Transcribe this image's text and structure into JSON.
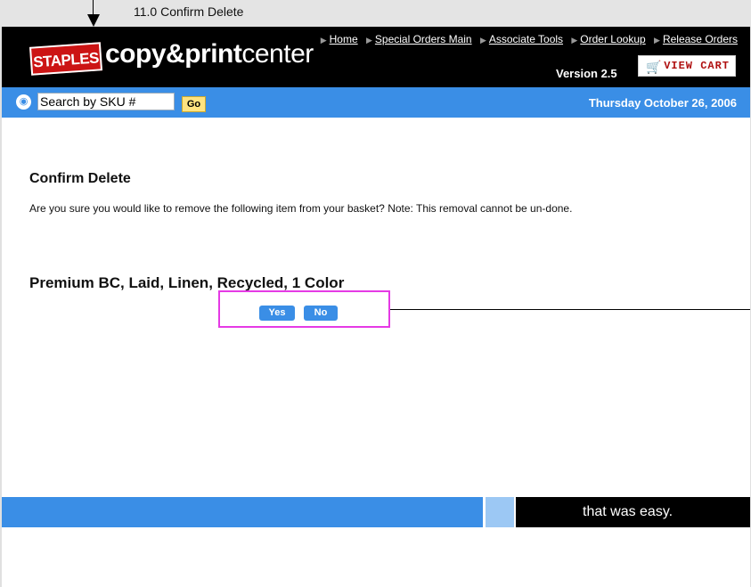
{
  "annotation": {
    "title": "11.0 Confirm Delete"
  },
  "header": {
    "brand_badge": "STAPLES",
    "brand_copy": "copy",
    "brand_amp": "&",
    "brand_print": "print",
    "brand_center": "center",
    "nav_links": [
      "Home",
      "Special Orders Main",
      "Associate Tools",
      "Order Lookup",
      "Release Orders"
    ],
    "version": "Version 2.5",
    "view_cart_label": "VIEW CART"
  },
  "search": {
    "value": "Search by SKU #",
    "go_label": "Go",
    "date": "Thursday October 26, 2006"
  },
  "main": {
    "title": "Confirm Delete",
    "message": "Are you sure you would like to remove the following item from your basket? Note: This removal cannot be un-done.",
    "item_name": "Premium BC, Laid, Linen, Recycled, 1 Color",
    "yes_label": "Yes",
    "no_label": "No"
  },
  "footer": {
    "tagline": "that was easy."
  },
  "colors": {
    "header_bg": "#000000",
    "bar_blue": "#3a8ee6",
    "go_yellow": "#ffe380",
    "brand_red": "#cc1414",
    "highlight": "#e53ae5"
  }
}
